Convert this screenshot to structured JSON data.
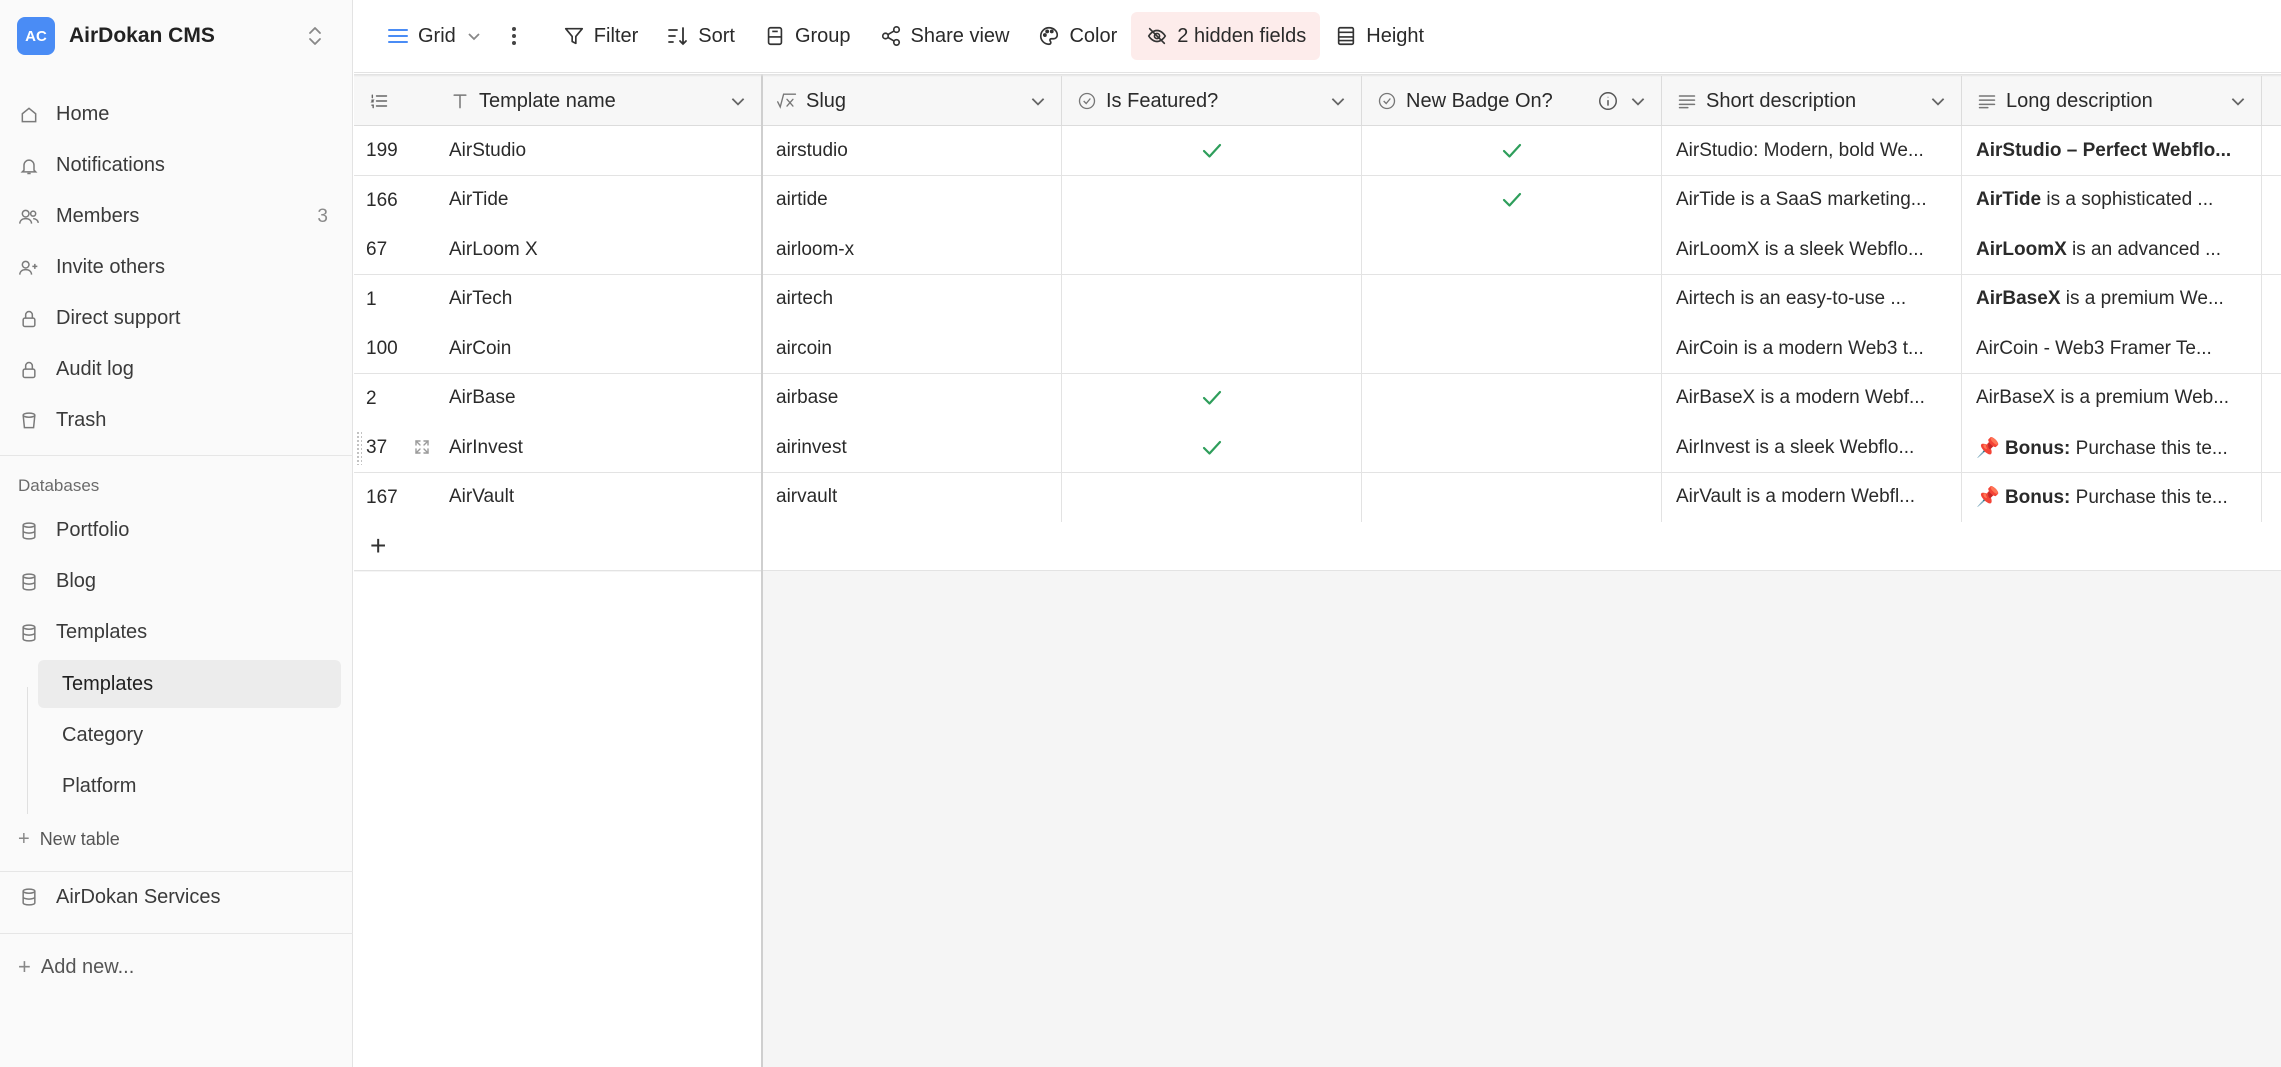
{
  "workspace": {
    "initials": "AC",
    "name": "AirDokan CMS"
  },
  "nav": [
    {
      "label": "Home",
      "icon": "home-icon"
    },
    {
      "label": "Notifications",
      "icon": "bell-icon"
    },
    {
      "label": "Members",
      "icon": "users-icon",
      "count": "3"
    },
    {
      "label": "Invite others",
      "icon": "user-plus-icon"
    },
    {
      "label": "Direct support",
      "icon": "lock-icon"
    },
    {
      "label": "Audit log",
      "icon": "lock-icon"
    },
    {
      "label": "Trash",
      "icon": "trash-icon"
    }
  ],
  "databases_label": "Databases",
  "databases": [
    {
      "label": "Portfolio",
      "icon": "database-icon"
    },
    {
      "label": "Blog",
      "icon": "database-icon"
    },
    {
      "label": "Templates",
      "icon": "database-icon"
    }
  ],
  "tables": [
    {
      "label": "Templates",
      "active": true
    },
    {
      "label": "Category",
      "active": false
    },
    {
      "label": "Platform",
      "active": false
    }
  ],
  "new_table_label": "New table",
  "services_label": "AirDokan Services",
  "add_new_label": "Add new...",
  "toolbar": {
    "view": "Grid",
    "filter": "Filter",
    "sort": "Sort",
    "group": "Group",
    "share": "Share view",
    "color": "Color",
    "hidden_fields": "2 hidden fields",
    "height": "Height"
  },
  "columns": [
    {
      "key": "name",
      "label": "Template name",
      "icon": "text-type-icon"
    },
    {
      "key": "slug",
      "label": "Slug",
      "icon": "formula-icon"
    },
    {
      "key": "featured",
      "label": "Is Featured?",
      "icon": "checkbox-circle-icon"
    },
    {
      "key": "badge",
      "label": "New Badge On?",
      "icon": "checkbox-circle-icon",
      "info": true
    },
    {
      "key": "short",
      "label": "Short description",
      "icon": "long-text-icon"
    },
    {
      "key": "long",
      "label": "Long description",
      "icon": "long-text-icon"
    }
  ],
  "rows": [
    {
      "id": "199",
      "name": "AirStudio",
      "slug": "airstudio",
      "featured": true,
      "badge": true,
      "short": "AirStudio: Modern, bold We...",
      "long_bold": "AirStudio – Perfect Webflo...",
      "long_rest": "",
      "long_pin": false
    },
    {
      "id": "166",
      "name": "AirTide",
      "slug": "airtide",
      "featured": false,
      "badge": true,
      "short": "AirTide is a SaaS marketing...",
      "long_bold": "AirTide",
      "long_rest": " is a sophisticated ...",
      "long_pin": false
    },
    {
      "id": "67",
      "name": "AirLoom X",
      "slug": "airloom-x",
      "featured": false,
      "badge": false,
      "short": "AirLoomX is a sleek Webflo...",
      "long_bold": "AirLoomX",
      "long_rest": " is an advanced ...",
      "long_pin": false
    },
    {
      "id": "1",
      "name": "AirTech",
      "slug": "airtech",
      "featured": false,
      "badge": false,
      "short": "Airtech is an easy-to-use ...",
      "long_bold": "AirBaseX",
      "long_rest": " is a premium We...",
      "long_pin": false
    },
    {
      "id": "100",
      "name": "AirCoin",
      "slug": "aircoin",
      "featured": false,
      "badge": false,
      "short": "AirCoin is a modern Web3 t...",
      "long_bold": "",
      "long_rest": "AirCoin - Web3 Framer Te...",
      "long_pin": false
    },
    {
      "id": "2",
      "name": "AirBase",
      "slug": "airbase",
      "featured": true,
      "badge": false,
      "short": "AirBaseX is a modern Webf...",
      "long_bold": "",
      "long_rest": "AirBaseX is a premium Web...",
      "long_pin": false
    },
    {
      "id": "37",
      "name": "AirInvest",
      "slug": "airinvest",
      "featured": true,
      "badge": false,
      "short": "AirInvest is a sleek Webflo...",
      "long_bold": "Bonus:",
      "long_rest": " Purchase this te...",
      "long_pin": true,
      "hover": true
    },
    {
      "id": "167",
      "name": "AirVault",
      "slug": "airvault",
      "featured": false,
      "badge": false,
      "short": "AirVault is a modern Webfl...",
      "long_bold": "Bonus:",
      "long_rest": " Purchase this te...",
      "long_pin": true
    }
  ],
  "colors": {
    "accent": "#4a8cf5",
    "check": "#2e9e5b",
    "hidden_bg": "#fdeceb"
  }
}
